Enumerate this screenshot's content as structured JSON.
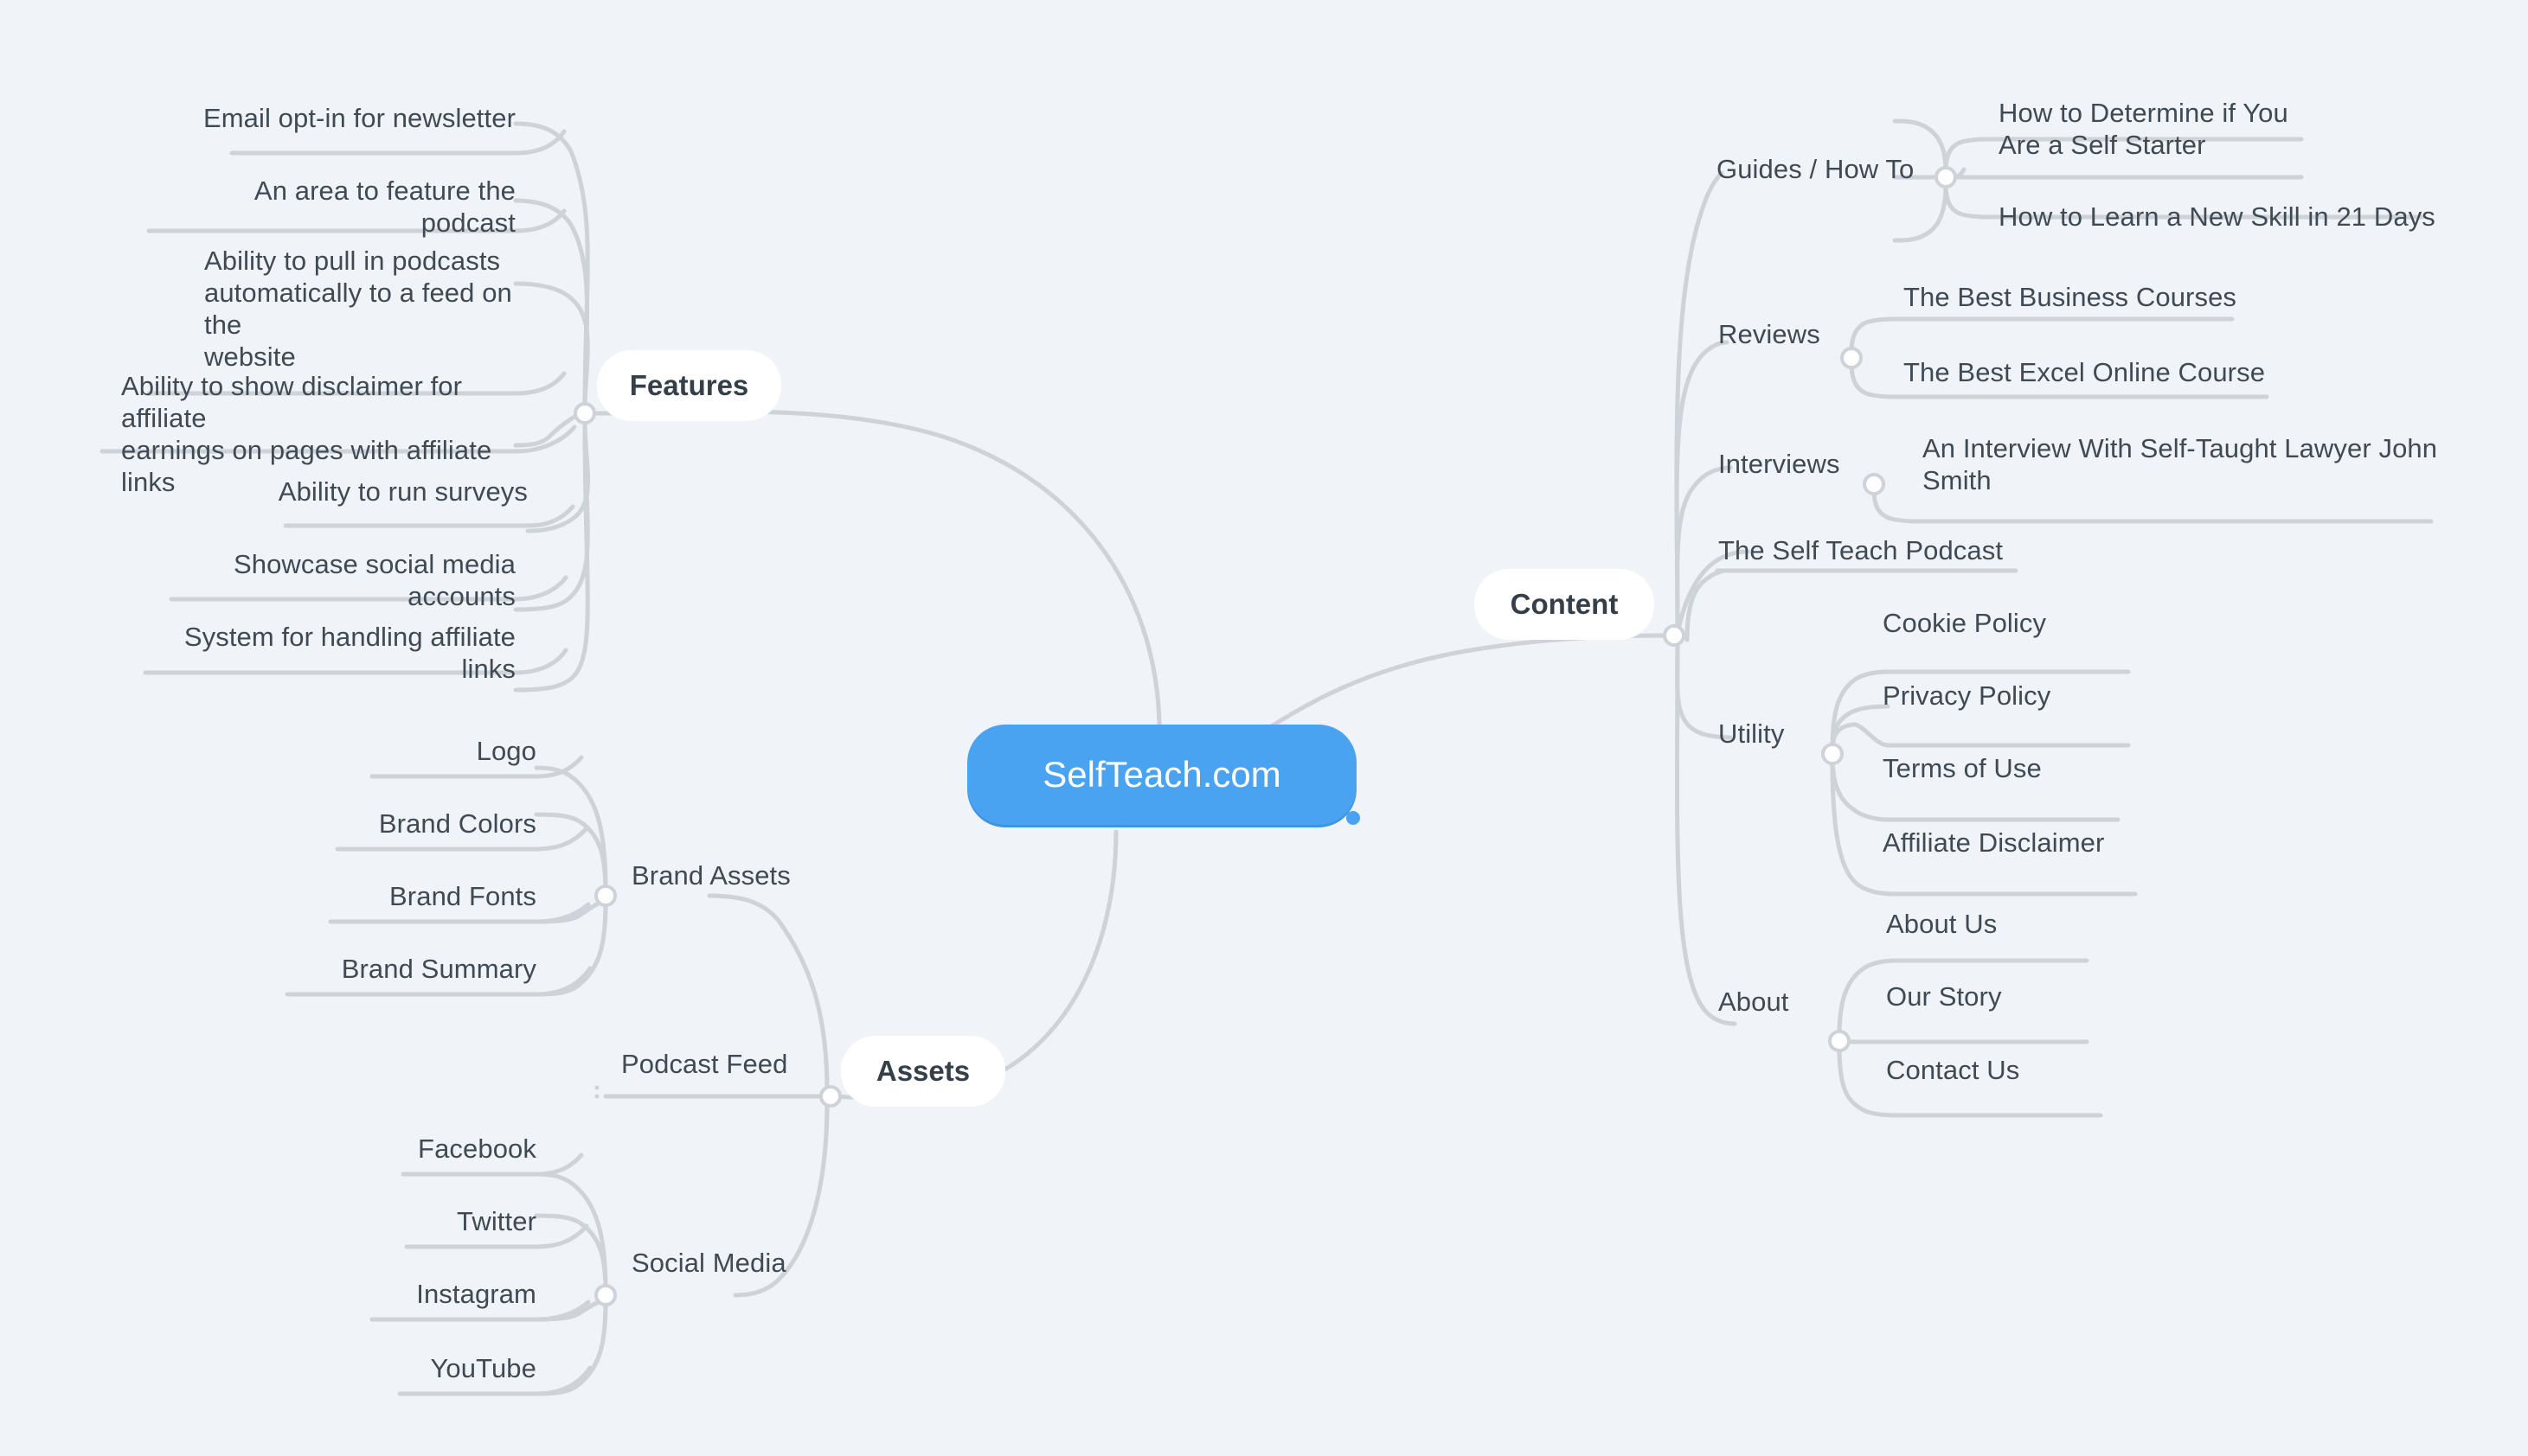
{
  "root": {
    "label": "SelfTeach.com",
    "color": "#4aa3f0"
  },
  "theme": {
    "background": "#f0f3f7",
    "line_color": "#cdd3d8",
    "text_color": "#3f4a54",
    "branch_pill_bg": "#ffffff"
  },
  "branches": [
    {
      "id": "features",
      "label": "Features",
      "side": "left",
      "items": [
        {
          "label": "Email opt-in for newsletter"
        },
        {
          "label": "An area to feature the podcast"
        },
        {
          "label": "Ability to pull in podcasts\nautomatically to a feed on the\nwebsite"
        },
        {
          "label": "Ability to show disclaimer for affiliate\nearnings on pages with affiliate links"
        },
        {
          "label": "Ability to run surveys"
        },
        {
          "label": "Showcase social media accounts"
        },
        {
          "label": "System for handling affiliate links"
        }
      ]
    },
    {
      "id": "assets",
      "label": "Assets",
      "side": "left",
      "groups": [
        {
          "label": "Brand Assets",
          "items": [
            {
              "label": "Logo"
            },
            {
              "label": "Brand Colors"
            },
            {
              "label": "Brand Fonts"
            },
            {
              "label": "Brand Summary"
            }
          ]
        },
        {
          "label": "Podcast Feed",
          "items": []
        },
        {
          "label": "Social Media",
          "items": [
            {
              "label": "Facebook"
            },
            {
              "label": "Twitter"
            },
            {
              "label": "Instagram"
            },
            {
              "label": "YouTube"
            }
          ]
        }
      ]
    },
    {
      "id": "content",
      "label": "Content",
      "side": "right",
      "groups": [
        {
          "label": "Guides / How To",
          "items": [
            {
              "label": "How to Determine if You\nAre a Self Starter"
            },
            {
              "label": "How to Learn a New Skill in 21 Days"
            }
          ]
        },
        {
          "label": "Reviews",
          "items": [
            {
              "label": "The Best Business Courses"
            },
            {
              "label": "The Best Excel Online Course"
            }
          ]
        },
        {
          "label": "Interviews",
          "items": [
            {
              "label": "An Interview With Self-Taught Lawyer John\nSmith"
            }
          ]
        },
        {
          "label": "The Self Teach Podcast",
          "items": []
        },
        {
          "label": "Utility",
          "items": [
            {
              "label": "Cookie Policy"
            },
            {
              "label": "Privacy Policy"
            },
            {
              "label": "Terms of Use"
            },
            {
              "label": "Affiliate Disclaimer"
            }
          ]
        },
        {
          "label": "About",
          "items": [
            {
              "label": "About Us"
            },
            {
              "label": "Our Story"
            },
            {
              "label": "Contact Us"
            }
          ]
        }
      ]
    }
  ]
}
